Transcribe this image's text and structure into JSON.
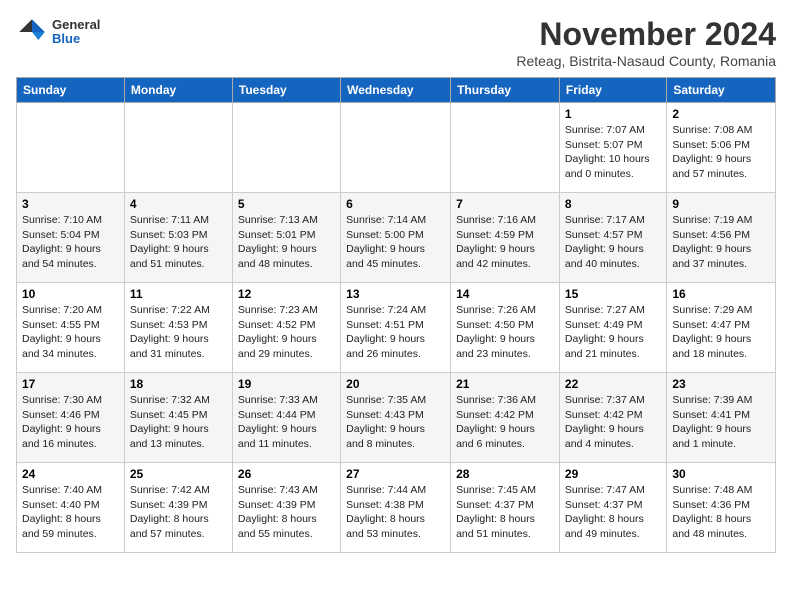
{
  "logo": {
    "general": "General",
    "blue": "Blue"
  },
  "title": "November 2024",
  "location": "Reteag, Bistrita-Nasaud County, Romania",
  "weekdays": [
    "Sunday",
    "Monday",
    "Tuesday",
    "Wednesday",
    "Thursday",
    "Friday",
    "Saturday"
  ],
  "weeks": [
    [
      {
        "day": "",
        "info": ""
      },
      {
        "day": "",
        "info": ""
      },
      {
        "day": "",
        "info": ""
      },
      {
        "day": "",
        "info": ""
      },
      {
        "day": "",
        "info": ""
      },
      {
        "day": "1",
        "info": "Sunrise: 7:07 AM\nSunset: 5:07 PM\nDaylight: 10 hours and 0 minutes."
      },
      {
        "day": "2",
        "info": "Sunrise: 7:08 AM\nSunset: 5:06 PM\nDaylight: 9 hours and 57 minutes."
      }
    ],
    [
      {
        "day": "3",
        "info": "Sunrise: 7:10 AM\nSunset: 5:04 PM\nDaylight: 9 hours and 54 minutes."
      },
      {
        "day": "4",
        "info": "Sunrise: 7:11 AM\nSunset: 5:03 PM\nDaylight: 9 hours and 51 minutes."
      },
      {
        "day": "5",
        "info": "Sunrise: 7:13 AM\nSunset: 5:01 PM\nDaylight: 9 hours and 48 minutes."
      },
      {
        "day": "6",
        "info": "Sunrise: 7:14 AM\nSunset: 5:00 PM\nDaylight: 9 hours and 45 minutes."
      },
      {
        "day": "7",
        "info": "Sunrise: 7:16 AM\nSunset: 4:59 PM\nDaylight: 9 hours and 42 minutes."
      },
      {
        "day": "8",
        "info": "Sunrise: 7:17 AM\nSunset: 4:57 PM\nDaylight: 9 hours and 40 minutes."
      },
      {
        "day": "9",
        "info": "Sunrise: 7:19 AM\nSunset: 4:56 PM\nDaylight: 9 hours and 37 minutes."
      }
    ],
    [
      {
        "day": "10",
        "info": "Sunrise: 7:20 AM\nSunset: 4:55 PM\nDaylight: 9 hours and 34 minutes."
      },
      {
        "day": "11",
        "info": "Sunrise: 7:22 AM\nSunset: 4:53 PM\nDaylight: 9 hours and 31 minutes."
      },
      {
        "day": "12",
        "info": "Sunrise: 7:23 AM\nSunset: 4:52 PM\nDaylight: 9 hours and 29 minutes."
      },
      {
        "day": "13",
        "info": "Sunrise: 7:24 AM\nSunset: 4:51 PM\nDaylight: 9 hours and 26 minutes."
      },
      {
        "day": "14",
        "info": "Sunrise: 7:26 AM\nSunset: 4:50 PM\nDaylight: 9 hours and 23 minutes."
      },
      {
        "day": "15",
        "info": "Sunrise: 7:27 AM\nSunset: 4:49 PM\nDaylight: 9 hours and 21 minutes."
      },
      {
        "day": "16",
        "info": "Sunrise: 7:29 AM\nSunset: 4:47 PM\nDaylight: 9 hours and 18 minutes."
      }
    ],
    [
      {
        "day": "17",
        "info": "Sunrise: 7:30 AM\nSunset: 4:46 PM\nDaylight: 9 hours and 16 minutes."
      },
      {
        "day": "18",
        "info": "Sunrise: 7:32 AM\nSunset: 4:45 PM\nDaylight: 9 hours and 13 minutes."
      },
      {
        "day": "19",
        "info": "Sunrise: 7:33 AM\nSunset: 4:44 PM\nDaylight: 9 hours and 11 minutes."
      },
      {
        "day": "20",
        "info": "Sunrise: 7:35 AM\nSunset: 4:43 PM\nDaylight: 9 hours and 8 minutes."
      },
      {
        "day": "21",
        "info": "Sunrise: 7:36 AM\nSunset: 4:42 PM\nDaylight: 9 hours and 6 minutes."
      },
      {
        "day": "22",
        "info": "Sunrise: 7:37 AM\nSunset: 4:42 PM\nDaylight: 9 hours and 4 minutes."
      },
      {
        "day": "23",
        "info": "Sunrise: 7:39 AM\nSunset: 4:41 PM\nDaylight: 9 hours and 1 minute."
      }
    ],
    [
      {
        "day": "24",
        "info": "Sunrise: 7:40 AM\nSunset: 4:40 PM\nDaylight: 8 hours and 59 minutes."
      },
      {
        "day": "25",
        "info": "Sunrise: 7:42 AM\nSunset: 4:39 PM\nDaylight: 8 hours and 57 minutes."
      },
      {
        "day": "26",
        "info": "Sunrise: 7:43 AM\nSunset: 4:39 PM\nDaylight: 8 hours and 55 minutes."
      },
      {
        "day": "27",
        "info": "Sunrise: 7:44 AM\nSunset: 4:38 PM\nDaylight: 8 hours and 53 minutes."
      },
      {
        "day": "28",
        "info": "Sunrise: 7:45 AM\nSunset: 4:37 PM\nDaylight: 8 hours and 51 minutes."
      },
      {
        "day": "29",
        "info": "Sunrise: 7:47 AM\nSunset: 4:37 PM\nDaylight: 8 hours and 49 minutes."
      },
      {
        "day": "30",
        "info": "Sunrise: 7:48 AM\nSunset: 4:36 PM\nDaylight: 8 hours and 48 minutes."
      }
    ]
  ]
}
